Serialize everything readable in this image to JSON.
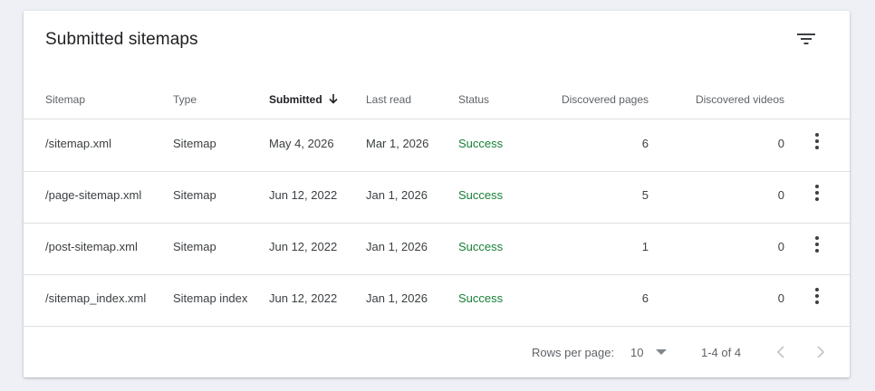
{
  "card": {
    "title": "Submitted sitemaps",
    "filter_icon": "filter-list-icon"
  },
  "table": {
    "headers": {
      "sitemap": "Sitemap",
      "type": "Type",
      "submitted": "Submitted",
      "last_read": "Last read",
      "status": "Status",
      "discovered_pages": "Discovered pages",
      "discovered_videos": "Discovered videos"
    },
    "sort": {
      "column": "submitted",
      "direction": "descending",
      "icon": "arrow-down-icon"
    },
    "rows": [
      {
        "sitemap": "/sitemap.xml",
        "type": "Sitemap",
        "submitted": "May 4, 2026",
        "last_read": "Mar 1, 2026",
        "status": "Success",
        "pages": "6",
        "videos": "0"
      },
      {
        "sitemap": "/page-sitemap.xml",
        "type": "Sitemap",
        "submitted": "Jun 12, 2022",
        "last_read": "Jan 1, 2026",
        "status": "Success",
        "pages": "5",
        "videos": "0"
      },
      {
        "sitemap": "/post-sitemap.xml",
        "type": "Sitemap",
        "submitted": "Jun 12, 2022",
        "last_read": "Jan 1, 2026",
        "status": "Success",
        "pages": "1",
        "videos": "0"
      },
      {
        "sitemap": "/sitemap_index.xml",
        "type": "Sitemap index",
        "submitted": "Jun 12, 2022",
        "last_read": "Jan 1, 2026",
        "status": "Success",
        "pages": "6",
        "videos": "0"
      }
    ],
    "row_action_icon": "more-vert-icon"
  },
  "footer": {
    "rows_per_page_label": "Rows per page:",
    "rows_per_page_value": "10",
    "range_text": "1-4 of 4",
    "prev_icon": "chevron-left-icon",
    "next_icon": "chevron-right-icon"
  },
  "colors": {
    "background": "#eef0f5",
    "status_success": "#188038",
    "text_secondary": "#5f6368",
    "divider": "#e0e0e0"
  }
}
